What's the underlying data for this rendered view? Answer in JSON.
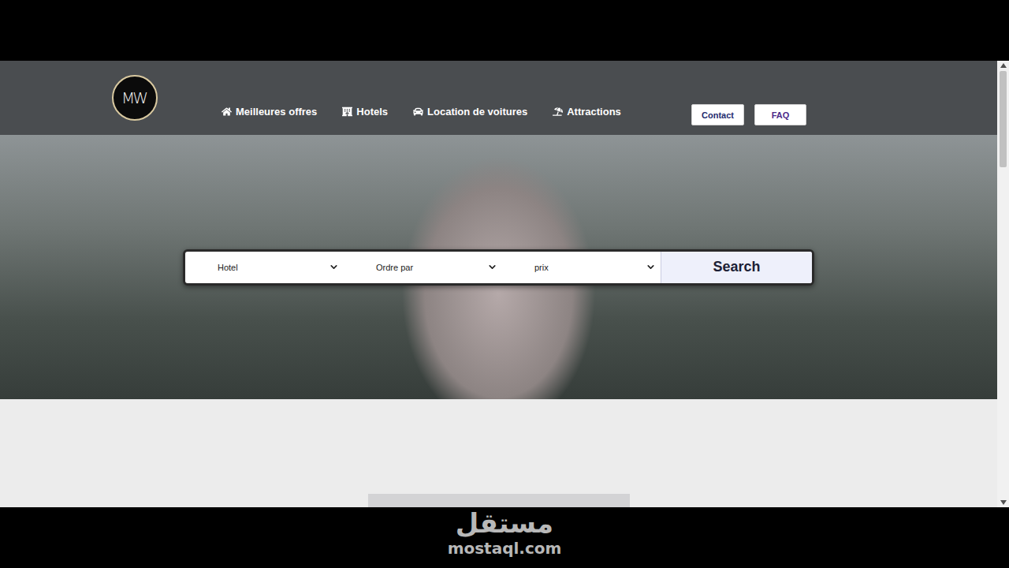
{
  "logo": {
    "text": "MW"
  },
  "nav": [
    {
      "label": "Meilleures offres"
    },
    {
      "label": "Hotels"
    },
    {
      "label": "Location de voitures"
    },
    {
      "label": "Attractions"
    }
  ],
  "header_buttons": [
    {
      "label": "Contact",
      "color": "#1e2a6e"
    },
    {
      "label": "FAQ",
      "color": "#4b2a8a"
    }
  ],
  "search": {
    "fields": [
      {
        "value": "Hotel"
      },
      {
        "value": "Ordre par"
      },
      {
        "value": "prix"
      }
    ],
    "button": "Search"
  },
  "watermark": {
    "arabic": "مستقل",
    "latin": "mostaql.com"
  }
}
